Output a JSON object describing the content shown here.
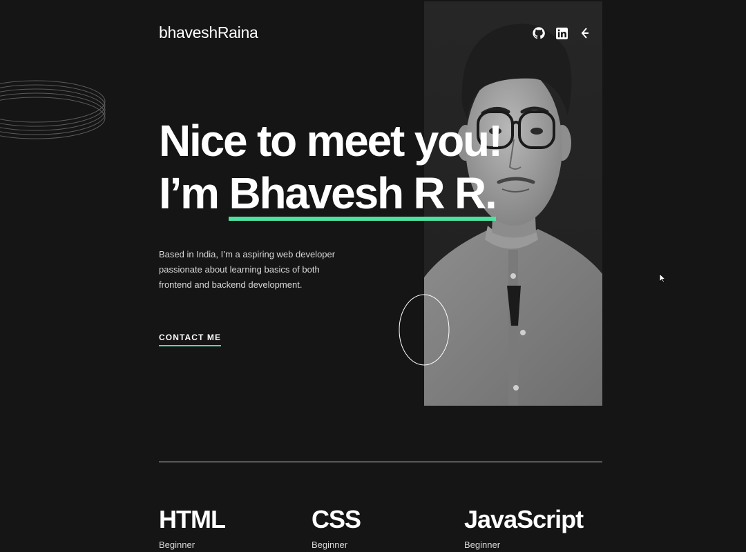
{
  "header": {
    "logo": "bhaveshRaina",
    "socials": [
      {
        "name": "github-icon"
      },
      {
        "name": "linkedin-icon"
      },
      {
        "name": "frontend-mentor-icon"
      }
    ]
  },
  "hero": {
    "line1": "Nice to meet you!",
    "line2_prefix": "I’m",
    "name": "Bhavesh R R.",
    "bio": "Based in India, I’m a aspiring web developer passionate about learning basics of both frontend and backend development.",
    "cta": "CONTACT ME"
  },
  "skills": [
    {
      "title": "HTML",
      "level": "Beginner"
    },
    {
      "title": "CSS",
      "level": "Beginner"
    },
    {
      "title": "JavaScript",
      "level": "Beginner"
    }
  ],
  "colors": {
    "background": "#151515",
    "accent": "#4ee1a0",
    "text": "#ffffff"
  }
}
